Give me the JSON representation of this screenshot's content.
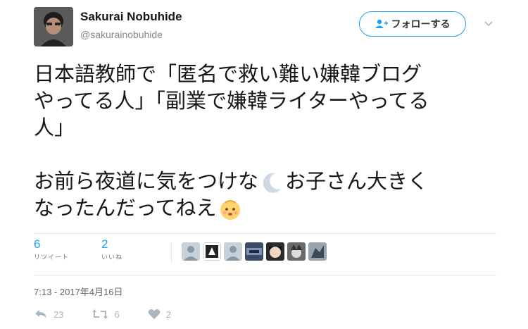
{
  "user": {
    "display_name": "Sakurai Nobuhide",
    "handle": "@sakurainobuhide"
  },
  "follow_button": {
    "label": "フォローする",
    "icon": "add-user-icon"
  },
  "tweet": {
    "lines": [
      "日本語教師で「匿名で救い難い嫌韓ブログ",
      "やってる人」「副業で嫌韓ライターやってる",
      "人」",
      "お前ら夜道に気をつけな",
      "お子さん大きく",
      "なったんだってねえ"
    ],
    "emojis": [
      "crescent-moon-icon",
      "baby-face-icon"
    ]
  },
  "stats": {
    "retweets": {
      "count": "6",
      "label": "リツイート"
    },
    "likes": {
      "count": "2",
      "label": "いいね"
    }
  },
  "timestamp": "7:13 - 2017年4月16日",
  "actions": {
    "reply": {
      "count": "23",
      "icon": "reply-icon"
    },
    "retweet": {
      "count": "6",
      "icon": "retweet-icon"
    },
    "like": {
      "count": "2",
      "icon": "heart-icon"
    }
  },
  "colors": {
    "accent": "#1da1f2",
    "text": "#14171a",
    "muted": "#aab8c2"
  }
}
